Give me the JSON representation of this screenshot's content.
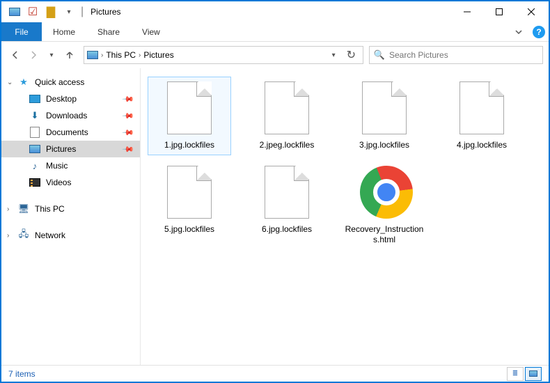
{
  "titlebar": {
    "title": "Pictures"
  },
  "ribbon": {
    "file": "File",
    "tabs": [
      "Home",
      "Share",
      "View"
    ]
  },
  "breadcrumb": {
    "items": [
      "This PC",
      "Pictures"
    ]
  },
  "search": {
    "placeholder": "Search Pictures"
  },
  "sidebar": {
    "quick_access": "Quick access",
    "items": [
      {
        "label": "Desktop",
        "icon": "desktop"
      },
      {
        "label": "Downloads",
        "icon": "downloads"
      },
      {
        "label": "Documents",
        "icon": "documents"
      },
      {
        "label": "Pictures",
        "icon": "pictures",
        "selected": true
      },
      {
        "label": "Music",
        "icon": "music"
      },
      {
        "label": "Videos",
        "icon": "videos"
      }
    ],
    "this_pc": "This PC",
    "network": "Network"
  },
  "files": [
    {
      "name": "1.jpg.lockfiles",
      "type": "blank",
      "selected": true
    },
    {
      "name": "2.jpeg.lockfiles",
      "type": "blank"
    },
    {
      "name": "3.jpg.lockfiles",
      "type": "blank"
    },
    {
      "name": "4.jpg.lockfiles",
      "type": "blank"
    },
    {
      "name": "5.jpg.lockfiles",
      "type": "blank"
    },
    {
      "name": "6.jpg.lockfiles",
      "type": "blank"
    },
    {
      "name": "Recovery_Instructions.html",
      "type": "chrome"
    }
  ],
  "status": {
    "count": "7 items"
  }
}
